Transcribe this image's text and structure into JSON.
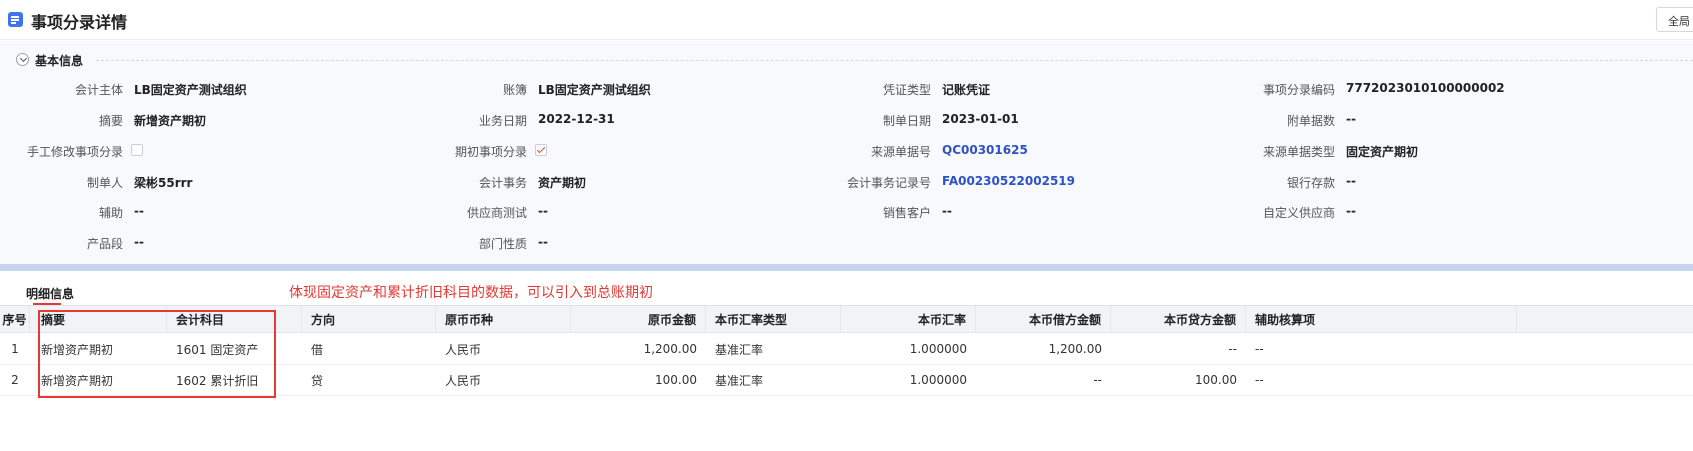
{
  "header": {
    "title": "事项分录详情",
    "global_button": "全局"
  },
  "info": {
    "section_title": "基本信息",
    "fields": {
      "accounting_entity": {
        "label": "会计主体",
        "value": "LB固定资产测试组织"
      },
      "ledger": {
        "label": "账簿",
        "value": "LB固定资产测试组织"
      },
      "voucher_type": {
        "label": "凭证类型",
        "value": "记账凭证"
      },
      "entry_code": {
        "label": "事项分录编码",
        "value": "7772023010100000002"
      },
      "summary": {
        "label": "摘要",
        "value": "新增资产期初"
      },
      "business_date": {
        "label": "业务日期",
        "value": "2022-12-31"
      },
      "create_date": {
        "label": "制单日期",
        "value": "2023-01-01"
      },
      "attachments": {
        "label": "附单据数",
        "value": "--"
      },
      "manual_edit": {
        "label": "手工修改事项分录",
        "checked": false
      },
      "opening_entry": {
        "label": "期初事项分录",
        "checked": true
      },
      "source_doc_no": {
        "label": "来源单据号",
        "value": "QC00301625"
      },
      "source_doc_type": {
        "label": "来源单据类型",
        "value": "固定资产期初"
      },
      "creator": {
        "label": "制单人",
        "value": "梁彬55rrr"
      },
      "accounting_event": {
        "label": "会计事务",
        "value": "资产期初"
      },
      "event_record_no": {
        "label": "会计事务记录号",
        "value": "FA00230522002519"
      },
      "bank_deposit": {
        "label": "银行存款",
        "value": "--"
      },
      "auxiliary": {
        "label": "辅助",
        "value": "--"
      },
      "supplier_test": {
        "label": "供应商测试",
        "value": "--"
      },
      "sales_customer": {
        "label": "销售客户",
        "value": "--"
      },
      "custom_supplier": {
        "label": "自定义供应商",
        "value": "--"
      },
      "product_segment": {
        "label": "产品段",
        "value": "--"
      },
      "department_nature": {
        "label": "部门性质",
        "value": "--"
      }
    }
  },
  "detail": {
    "tab_label": "明细信息",
    "annotation": "体现固定资产和累计折旧科目的数据，可以引入到总账期初",
    "columns": [
      "序号",
      "摘要",
      "会计科目",
      "方向",
      "原币币种",
      "原币金额",
      "本币汇率类型",
      "本币汇率",
      "本币借方金额",
      "本币贷方金额",
      "辅助核算项"
    ],
    "rows": [
      {
        "seq": "1",
        "summary": "新增资产期初",
        "account": "1601 固定资产",
        "direction": "借",
        "currency": "人民币",
        "orig_amount": "1,200.00",
        "rate_type": "基准汇率",
        "rate": "1.000000",
        "debit": "1,200.00",
        "credit": "--",
        "aux": "--"
      },
      {
        "seq": "2",
        "summary": "新增资产期初",
        "account": "1602 累计折旧",
        "direction": "贷",
        "currency": "人民币",
        "orig_amount": "100.00",
        "rate_type": "基准汇率",
        "rate": "1.000000",
        "debit": "--",
        "credit": "100.00",
        "aux": "--"
      }
    ]
  },
  "colors": {
    "accent": "#3f73f0",
    "link": "#2d52c4",
    "annotation_red": "#e53935",
    "divider": "#c7d4ee"
  }
}
